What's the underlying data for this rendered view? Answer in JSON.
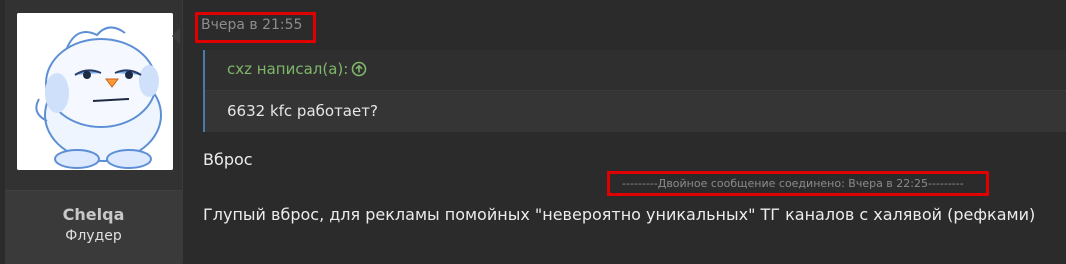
{
  "user": {
    "name": "Chelqa",
    "title": "Флудер",
    "avatar": "cartoon-blob-avatar"
  },
  "post": {
    "timestamp": "Вчера в 21:55",
    "quote": {
      "author": "cxz написал(а):",
      "icon": "arrow-up-circle-icon",
      "text": "6632 kfc работает?"
    },
    "message_1": "Вброс",
    "merge_note": "---------Двойное сообщение соединено: Вчера в 22:25---------",
    "message_2": "Глупый вброс, для рекламы помойных \"невероятно уникальных\" ТГ каналов с халявой (рефками)"
  },
  "colors": {
    "highlight": "#e10000",
    "quote_author": "#7fb66a",
    "quote_border": "#4a7aa8"
  }
}
